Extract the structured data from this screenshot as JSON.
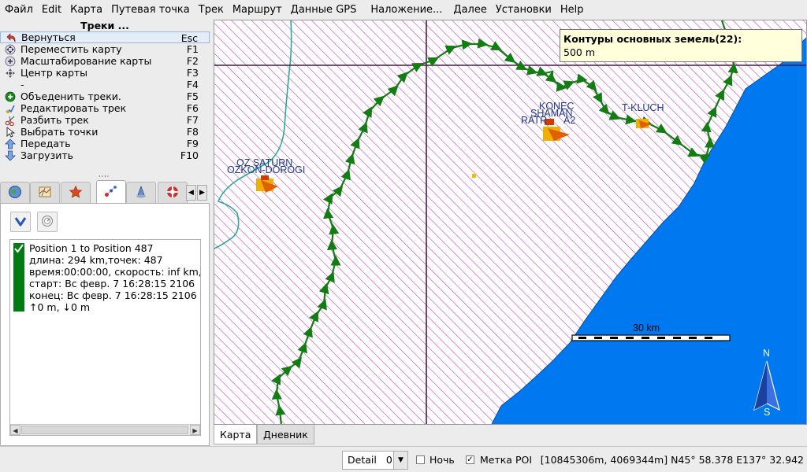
{
  "menubar": {
    "items": [
      "Файл",
      "Edit",
      "Карта",
      "Путевая точка",
      "Трек",
      "Маршрут",
      "Данные GPS",
      "Наложение...",
      "Далее",
      "Установки",
      "Help"
    ]
  },
  "tracks_panel": {
    "title": "Треки ...",
    "actions": [
      {
        "label": "Вернуться",
        "key": "Esc",
        "icon": "undo-icon"
      },
      {
        "label": "Переместить карту",
        "key": "F1",
        "icon": "move-icon"
      },
      {
        "label": "Масштабирование карты",
        "key": "F2",
        "icon": "zoom-icon"
      },
      {
        "label": "Центр карты",
        "key": "F3",
        "icon": "center-icon"
      },
      {
        "label": "-",
        "key": "F4",
        "icon": ""
      },
      {
        "label": "Объеденить треки.",
        "key": "F5",
        "icon": "join-icon"
      },
      {
        "label": "Редактировать трек",
        "key": "F6",
        "icon": "edit-icon"
      },
      {
        "label": "Разбить трек",
        "key": "F7",
        "icon": "scissors-icon"
      },
      {
        "label": "Выбрать точки",
        "key": "F8",
        "icon": "select-icon"
      },
      {
        "label": "Передать",
        "key": "F9",
        "icon": "upload-icon"
      },
      {
        "label": "Загрузить",
        "key": "F10",
        "icon": "download-icon"
      }
    ],
    "tabs": [
      "globe-icon",
      "map-icon",
      "star-icon",
      "track-icon",
      "waypoint-icon",
      "lifebuoy-icon"
    ],
    "track": {
      "lines": [
        "Position 1 to Position 487",
        "длина: 294 km,точек: 487",
        "время:00:00:00, скорость: inf km,",
        "старт: Вс февр. 7 16:28:15 2106",
        "конец: Вс февр. 7 16:28:15 2106",
        "↑0 m, ↓0 m"
      ],
      "color": "#007a12"
    }
  },
  "map": {
    "tooltip_title": "Контуры основных земель(22):",
    "tooltip_value": "500 m",
    "labels": {
      "oz_saturn": "OZ SATURN",
      "oz_kon_dorogi": "OZKON-DOROGI",
      "konec": "KONEC",
      "shaman": "SHAMAN",
      "ratr": "RATR",
      "a2": "A2",
      "t_kluch": "T-KLUCH"
    },
    "scale_label": "30 km",
    "compass_n": "N",
    "compass_s": "S",
    "colors": {
      "land_hatch": "#c040c0",
      "water": "#0078f0",
      "track": "#137d13",
      "river": "#2aa89a"
    }
  },
  "map_tabs": [
    "Карта",
    "Дневник"
  ],
  "statusbar": {
    "detail_label": "Detail",
    "detail_value": "0",
    "night_label": "Ночь",
    "poi_label": "Метка POI",
    "coords": "[10845306m, 4069344m] N45° 58.378 E137° 32.942"
  }
}
